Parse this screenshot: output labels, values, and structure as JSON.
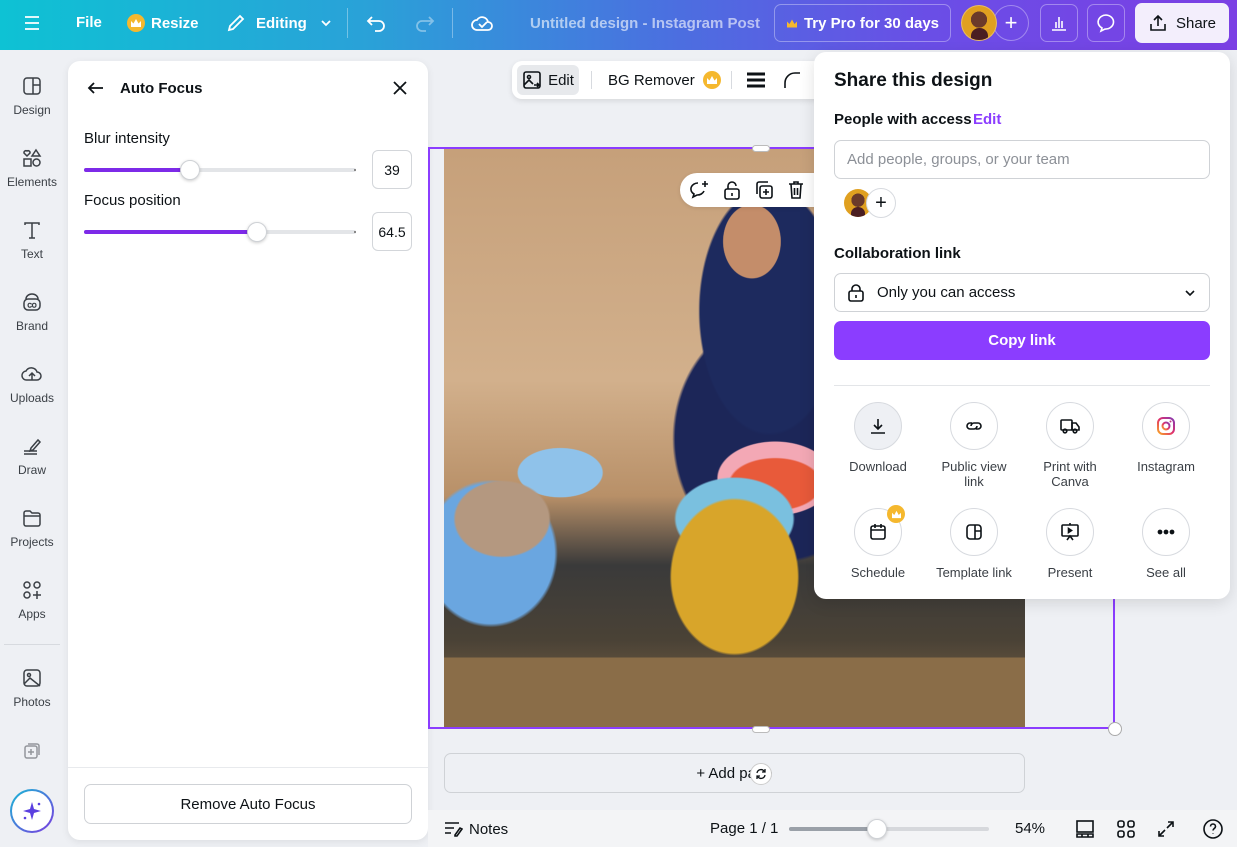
{
  "topbar": {
    "menu_icon": "hamburger-icon",
    "file_label": "File",
    "resize_label": "Resize",
    "editing_label": "Editing",
    "doc_title": "Untitled design - Instagram Post",
    "try_pro_label": "Try Pro for 30 days",
    "add_collaborator": "+",
    "share_label": "Share"
  },
  "rail": {
    "items": [
      {
        "label": "Design",
        "icon": "design-icon"
      },
      {
        "label": "Elements",
        "icon": "elements-icon"
      },
      {
        "label": "Text",
        "icon": "text-icon"
      },
      {
        "label": "Brand",
        "icon": "brand-icon"
      },
      {
        "label": "Uploads",
        "icon": "uploads-icon"
      },
      {
        "label": "Draw",
        "icon": "draw-icon"
      },
      {
        "label": "Projects",
        "icon": "projects-icon"
      },
      {
        "label": "Apps",
        "icon": "apps-icon"
      },
      {
        "label": "Photos",
        "icon": "photos-icon"
      }
    ]
  },
  "panel": {
    "title": "Auto Focus",
    "sliders": [
      {
        "label": "Blur intensity",
        "value": "39",
        "fraction": 0.39
      },
      {
        "label": "Focus position",
        "value": "64.5",
        "fraction": 0.635
      }
    ],
    "remove_label": "Remove Auto Focus"
  },
  "edit_toolbar": {
    "edit_label": "Edit",
    "bg_remover_label": "BG Remover"
  },
  "canvas": {
    "add_page_label": "+ Add page"
  },
  "bottombar": {
    "notes_label": "Notes",
    "page_label": "Page 1 / 1",
    "zoom_label": "54%",
    "zoom_fraction": 0.44
  },
  "share": {
    "title": "Share this design",
    "people_label": "People with access",
    "edit_label": "Edit",
    "input_placeholder": "Add people, groups, or your team",
    "input_value": "",
    "collab_label": "Collaboration link",
    "access_value": "Only you can access",
    "copy_label": "Copy link",
    "options": [
      {
        "label": "Download",
        "icon": "download-icon"
      },
      {
        "label": "Public view link",
        "icon": "link-icon"
      },
      {
        "label": "Print with Canva",
        "icon": "truck-icon"
      },
      {
        "label": "Instagram",
        "icon": "instagram-icon"
      },
      {
        "label": "Schedule",
        "icon": "calendar-icon"
      },
      {
        "label": "Template link",
        "icon": "template-icon"
      },
      {
        "label": "Present",
        "icon": "present-icon"
      },
      {
        "label": "See all",
        "icon": "more-icon"
      }
    ]
  },
  "colors": {
    "accent": "#8b3dff",
    "pro": "#f5b82e"
  }
}
